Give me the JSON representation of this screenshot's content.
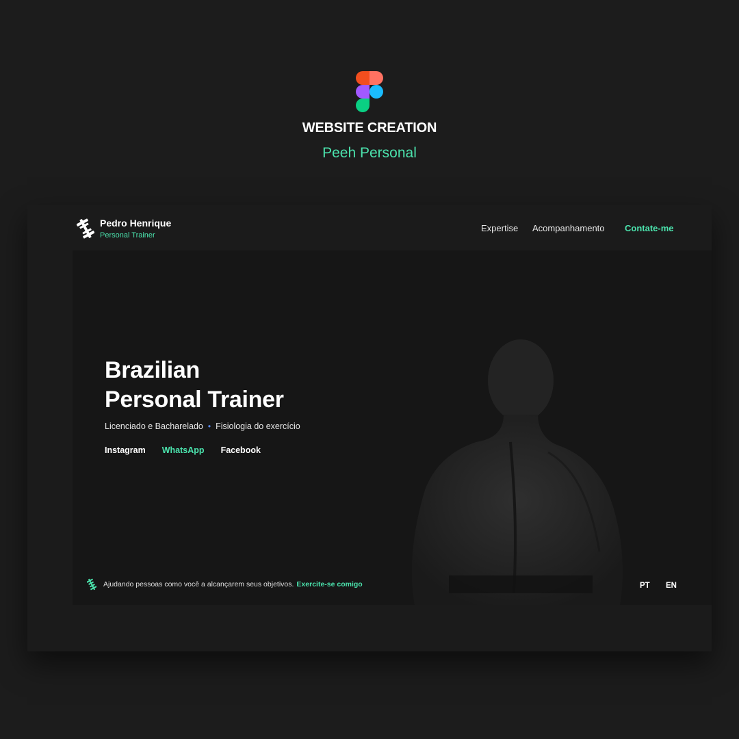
{
  "header": {
    "logo": "figma-logo",
    "title": "WEBSITE CREATION",
    "subtitle": "Peeh Personal"
  },
  "site": {
    "brand": {
      "icon": "dumbbell-icon",
      "name": "Pedro Henrique",
      "role": "Personal Trainer"
    },
    "nav": {
      "items": [
        {
          "label": "Expertise"
        },
        {
          "label": "Acompanhamento"
        },
        {
          "label": "Contate-me"
        }
      ]
    },
    "hero": {
      "title_line1": "Brazilian",
      "title_line2": "Personal Trainer",
      "tagline_left": "Licenciado e Bacharelado",
      "tagline_separator": "•",
      "tagline_right": "Fisiologia do exercício",
      "social": {
        "instagram": "Instagram",
        "whatsapp": "WhatsApp",
        "facebook": "Facebook"
      }
    },
    "footer": {
      "icon": "dumbbell-icon",
      "text": "Ajudando pessoas como você a alcançarem seus objetivos.",
      "cta": "Exercite-se comigo",
      "languages": [
        "PT",
        "EN"
      ]
    }
  },
  "colors": {
    "background": "#1c1c1c",
    "accent": "#4be3ad",
    "separator": "#5b8cff"
  }
}
